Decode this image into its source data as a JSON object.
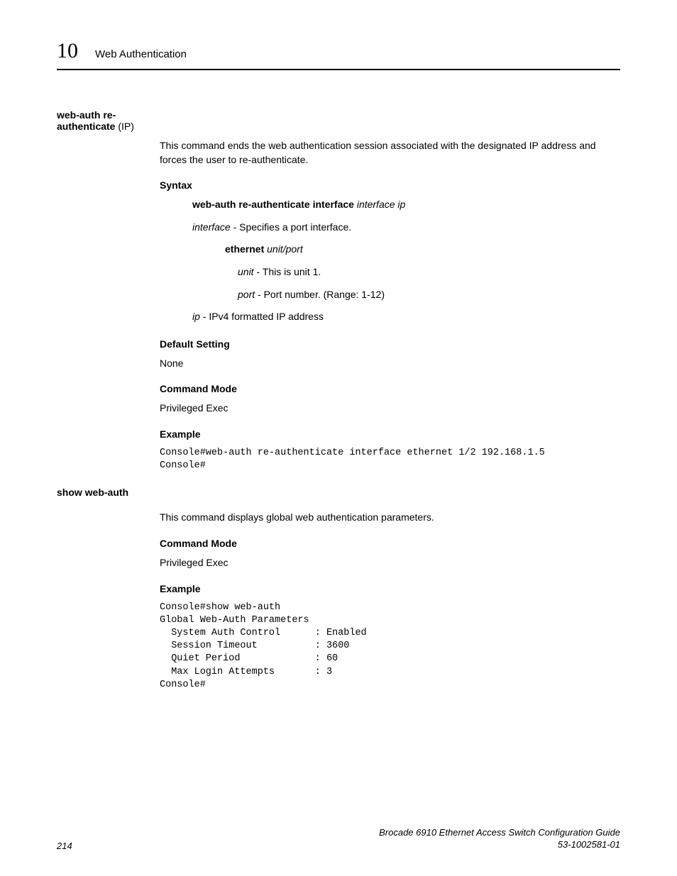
{
  "header": {
    "chapter_num": "10",
    "chapter_title": "Web Authentication"
  },
  "cmd1": {
    "name_bold": "web-auth re-authenticate",
    "name_rest": " (IP)",
    "desc": "This command ends the web authentication session associated with the designated IP address and forces the user to re-authenticate.",
    "syntax_head": "Syntax",
    "syntax_cmd_bold": "web-auth re-authenticate interface",
    "syntax_cmd_italic": " interface ip",
    "iface_italic": "interface",
    "iface_rest": " - Specifies a port interface.",
    "eth_bold": "ethernet",
    "eth_italic": " unit/port",
    "unit_italic": "unit",
    "unit_rest": " - This is unit 1.",
    "port_italic": "port",
    "port_rest": " - Port number. (Range: 1-12)",
    "ip_italic": "ip",
    "ip_rest": " - IPv4 formatted IP address",
    "default_head": "Default Setting",
    "default_text": "None",
    "mode_head": "Command Mode",
    "mode_text": "Privileged Exec",
    "example_head": "Example",
    "example_code": "Console#web-auth re-authenticate interface ethernet 1/2 192.168.1.5\nConsole#"
  },
  "cmd2": {
    "name": "show web-auth",
    "desc": "This command displays global web authentication parameters.",
    "mode_head": "Command Mode",
    "mode_text": "Privileged Exec",
    "example_head": "Example",
    "example_code": "Console#show web-auth\nGlobal Web-Auth Parameters\n  System Auth Control      : Enabled\n  Session Timeout          : 3600\n  Quiet Period             : 60\n  Max Login Attempts       : 3\nConsole#"
  },
  "footer": {
    "page_num": "214",
    "doc_title": "Brocade 6910 Ethernet Access Switch Configuration Guide",
    "doc_id": "53-1002581-01"
  }
}
